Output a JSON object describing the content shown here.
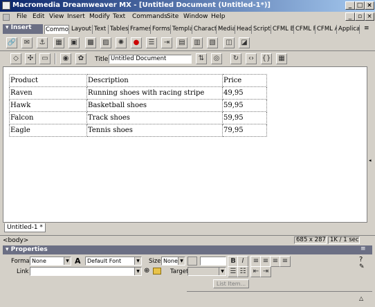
{
  "window": {
    "title": "Macromedia Dreamweaver MX - [Untitled Document (Untitled-1*)]"
  },
  "menu": [
    "File",
    "Edit",
    "View",
    "Insert",
    "Modify",
    "Text",
    "Commands",
    "Site",
    "Window",
    "Help"
  ],
  "insert_panel": {
    "title": "Insert",
    "tabs": [
      "Common",
      "Layout",
      "Text",
      "Tables",
      "Frames",
      "Forms",
      "Templa",
      "Charact",
      "Media",
      "Head",
      "Script",
      "CFML B",
      "CFML F",
      "CFML A",
      "Applica"
    ],
    "active_tab": "Common"
  },
  "doc_toolbar": {
    "title_label": "Title:",
    "title_value": "Untitled Document"
  },
  "document": {
    "table": [
      [
        "Product",
        "Description",
        "Price"
      ],
      [
        "Raven",
        "Running shoes with racing stripe",
        "49,95"
      ],
      [
        "Hawk",
        "Basketball shoes",
        "59,95"
      ],
      [
        "Falcon",
        "Track shoes",
        "59,95"
      ],
      [
        "Eagle",
        "Tennis shoes",
        "79,95"
      ]
    ]
  },
  "doc_tab": "Untitled-1 *",
  "status": {
    "tag": "<body>",
    "size": "685 x 287",
    "download": "1K / 1 sec"
  },
  "properties": {
    "title": "Properties",
    "format_label": "Format",
    "format_value": "None",
    "font_value": "Default Font",
    "size_label": "Size",
    "size_value": "None",
    "link_label": "Link",
    "target_label": "Target",
    "list_item": "List Item..."
  }
}
